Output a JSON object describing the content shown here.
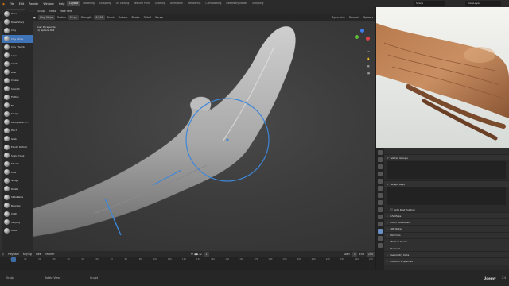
{
  "topbar": {
    "menus": [
      "File",
      "Edit",
      "Render",
      "Window",
      "Help"
    ],
    "workspaces": [
      "Layout",
      "Modeling",
      "Sculpting",
      "UV Editing",
      "Texture Paint",
      "Shading",
      "Animation",
      "Rendering",
      "Compositing",
      "Geometry Nodes",
      "Scripting"
    ],
    "active_workspace": "Layout",
    "scene": "Scene",
    "view_layer": "ViewLayer"
  },
  "header": {
    "mode": "Sculpt Mode",
    "menus": [
      "View",
      "Sculpt",
      "Mask",
      "Face Sets"
    ],
    "brush": "Clay Strips",
    "radius_label": "Radius",
    "radius_value": "50 px",
    "strength_label": "Strength",
    "strength_value": "0.500",
    "brush_menu": "Brush",
    "texture_menu": "Texture",
    "stroke_menu": "Stroke",
    "falloff_menu": "Falloff",
    "cursor_menu": "Cursor",
    "symmetry": "Symmetry",
    "remesh": "Remesh",
    "options": "Options"
  },
  "viewport_info": {
    "line1": "User Perspective",
    "line2": "(1) Sphere.002"
  },
  "brushes": [
    "Draw",
    "Draw Sharp",
    "Clay",
    "Clay Strips",
    "Clay Thumb",
    "Layer",
    "Inflate",
    "Blob",
    "Crease",
    "Smooth",
    "Flatten",
    "Fill",
    "Scrape",
    "Multi-plane Sc...",
    "Pinch",
    "Grab",
    "Elastic Deform",
    "Snake Hook",
    "Thumb",
    "Pose",
    "Nudge",
    "Rotate",
    "Slide Relax",
    "Boundary",
    "Cloth",
    "Simplify",
    "Mask"
  ],
  "active_brush_index": 3,
  "properties": {
    "vertex_groups": "Vertex Groups",
    "shape_keys": "Shape Keys",
    "add_rest_position": "Add Rest Position",
    "sections": [
      "UV Maps",
      "Color Attributes",
      "Attributes",
      "Normals",
      "Texture Space",
      "Remesh",
      "Geometry Data",
      "Custom Properties"
    ]
  },
  "timeline": {
    "menus": [
      "Playback",
      "Keying",
      "View",
      "Marker"
    ],
    "current_frame": "1",
    "start_label": "Start",
    "start": "1",
    "end_label": "End",
    "end": "250",
    "ticks": [
      "0",
      "10",
      "20",
      "30",
      "40",
      "50",
      "60",
      "70",
      "80",
      "90",
      "100",
      "110",
      "120",
      "130",
      "140",
      "150",
      "160",
      "170",
      "180",
      "190",
      "200",
      "210",
      "220",
      "230",
      "240",
      "250"
    ]
  },
  "statusbar": {
    "items": [
      "Sculpt",
      "Rotate View",
      "Sculpt"
    ],
    "version": "3.4"
  },
  "colors": {
    "accent": "#3f74b8",
    "gizmo_x": "#e0404a",
    "gizmo_y": "#5fbf3a",
    "gizmo_z": "#3e7ef0"
  },
  "watermark": "Udemy"
}
